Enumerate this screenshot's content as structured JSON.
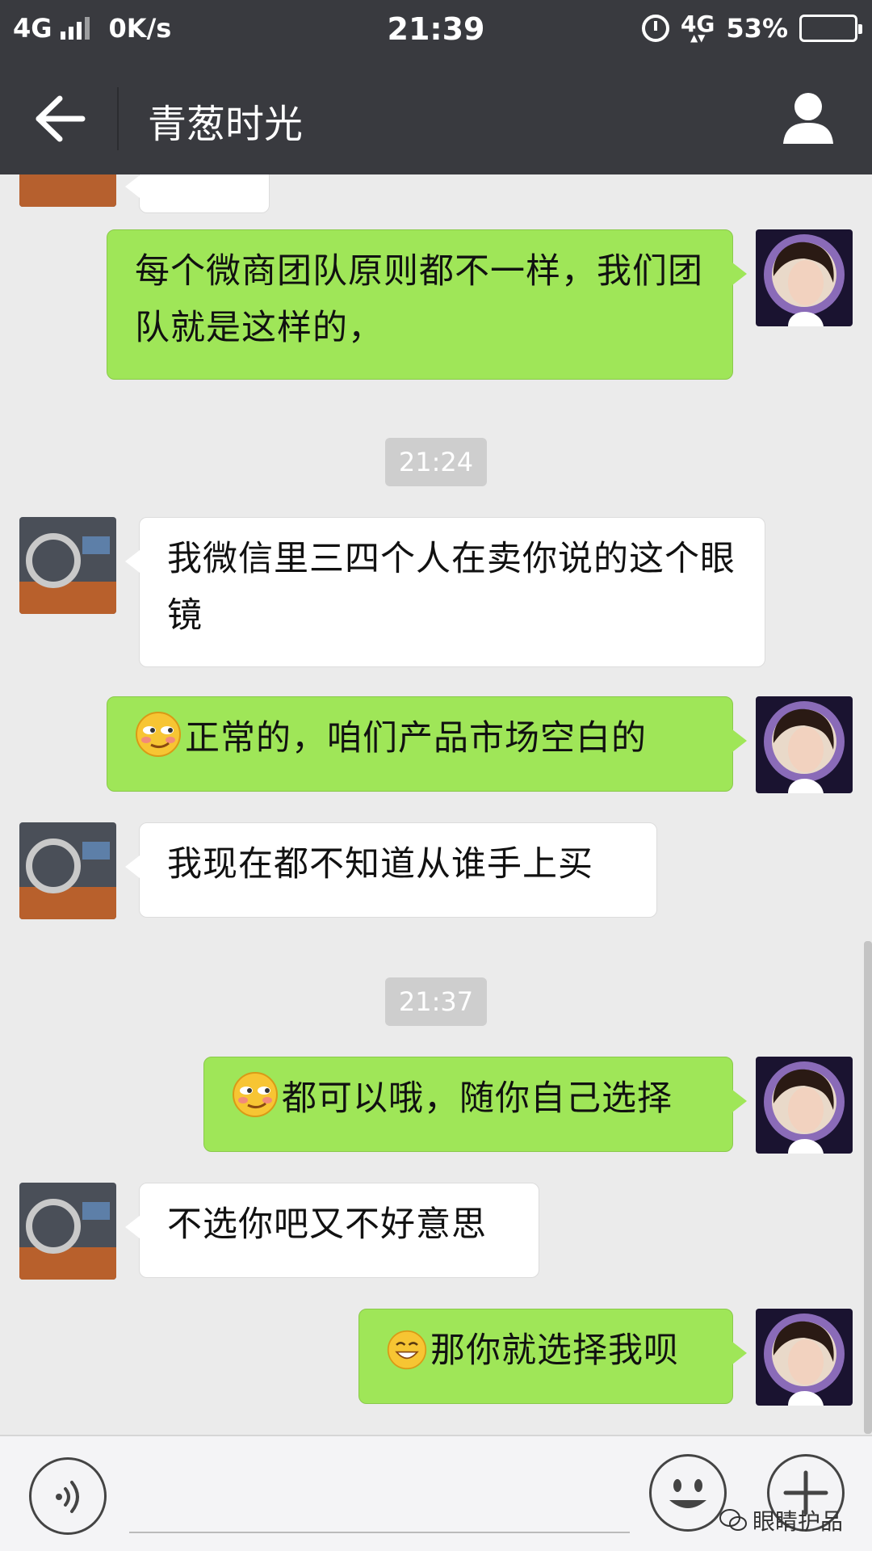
{
  "status_bar": {
    "network_left": "4G",
    "speed": "0K/s",
    "time": "21:39",
    "network_right": "4G",
    "battery": "53%",
    "battery_level": 0.53
  },
  "header": {
    "title": "青葱时光",
    "back_icon": "arrow-left-icon",
    "profile_icon": "person-icon"
  },
  "colors": {
    "header_bg": "#393a3f",
    "chat_bg": "#ebebeb",
    "outgoing_bubble": "#9fe658",
    "incoming_bubble": "#ffffff"
  },
  "messages": [
    {
      "side": "out",
      "text": "每个微商团队原则都不一样，我们团队就是这样的，",
      "emoji": null
    },
    {
      "type": "timestamp",
      "text": "21:24"
    },
    {
      "side": "in",
      "text": "我微信里三四个人在卖你说的这个眼镜",
      "emoji": null
    },
    {
      "side": "out",
      "text": "正常的，咱们产品市场空白的",
      "emoji": "smirk-emoji"
    },
    {
      "side": "in",
      "text": "我现在都不知道从谁手上买",
      "emoji": null
    },
    {
      "type": "timestamp",
      "text": "21:37"
    },
    {
      "side": "out",
      "text": "都可以哦，随你自己选择",
      "emoji": "smirk-emoji"
    },
    {
      "side": "in",
      "text": "不选你吧又不好意思",
      "emoji": null
    },
    {
      "side": "out",
      "text": "那你就选择我呗",
      "emoji": "grin-emoji"
    }
  ],
  "input_bar": {
    "voice_icon": "voice-icon",
    "emoji_icon": "smiley-icon",
    "plus_icon": "plus-icon",
    "watermark": "眼睛护品"
  }
}
